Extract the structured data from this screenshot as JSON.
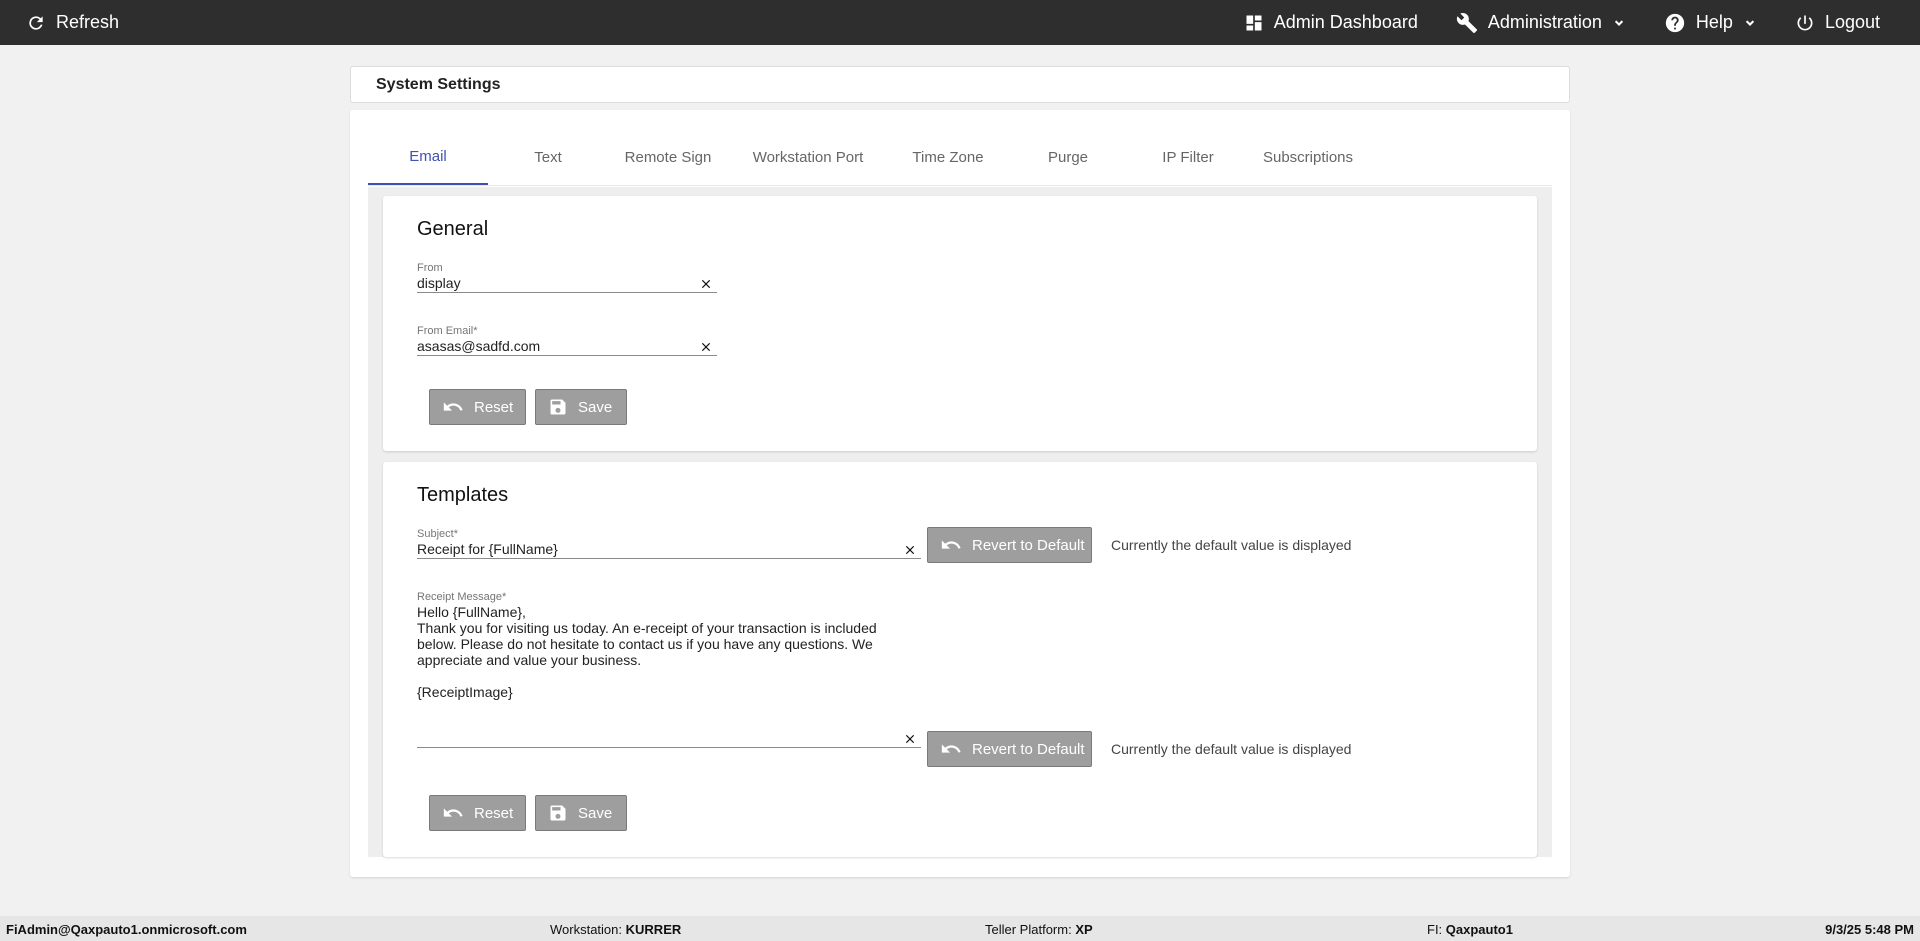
{
  "topbar": {
    "refresh_label": "Refresh",
    "admin_dashboard_label": "Admin Dashboard",
    "administration_label": "Administration",
    "help_label": "Help",
    "logout_label": "Logout"
  },
  "page": {
    "title": "System Settings"
  },
  "tabs": [
    "Email",
    "Text",
    "Remote Sign",
    "Workstation Port",
    "Time Zone",
    "Purge",
    "IP Filter",
    "Subscriptions"
  ],
  "active_tab": "Email",
  "general": {
    "title": "General",
    "from_label": "From",
    "from_value": "display",
    "from_email_label": "From Email*",
    "from_email_value": "asasas@sadfd.com",
    "reset_label": "Reset",
    "save_label": "Save"
  },
  "templates": {
    "title": "Templates",
    "subject_label": "Subject*",
    "subject_value": "Receipt for {FullName}",
    "revert_label": "Revert to Default",
    "default_note": "Currently the default value is displayed",
    "message_label": "Receipt Message*",
    "message_lines": [
      "Hello {FullName},",
      "Thank you for visiting us today. An e-receipt of your transaction is included below. Please do not hesitate to contact us if you have any questions. We appreciate and value your business.",
      "",
      "{ReceiptImage}"
    ],
    "reset_label": "Reset",
    "save_label": "Save"
  },
  "footer": {
    "user": "FiAdmin@Qaxpauto1.onmicrosoft.com",
    "workstation_label": "Workstation:",
    "workstation_value": "KURRER",
    "platform_label": "Teller Platform:",
    "platform_value": "XP",
    "fi_label": "FI:",
    "fi_value": "Qaxpauto1",
    "datetime": "9/3/25 5:48 PM"
  },
  "colors": {
    "topbar": "#2e2e2e",
    "accent": "#3f51b5",
    "button_gray": "#9e9e9e"
  },
  "icons": {
    "refresh": "refresh-icon",
    "dashboard": "dashboard-icon",
    "admin": "wrench-icon",
    "help": "help-icon",
    "logout": "power-icon",
    "reset": "undo-icon",
    "save": "floppy-icon",
    "clear": "close-icon"
  }
}
